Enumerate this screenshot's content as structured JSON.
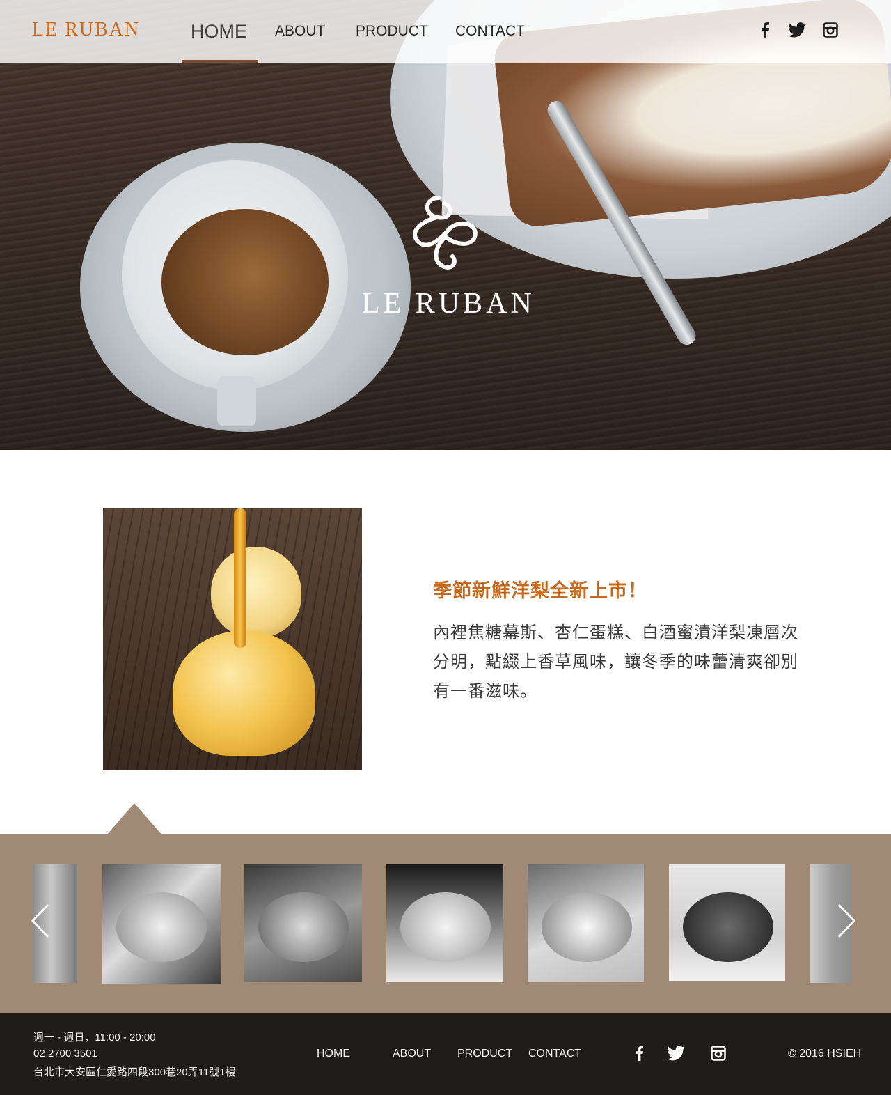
{
  "header": {
    "brand": "LE RUBAN",
    "nav": [
      {
        "label": "HOME",
        "active": true
      },
      {
        "label": "ABOUT"
      },
      {
        "label": "PRODUCT"
      },
      {
        "label": "CONTACT"
      }
    ],
    "social": [
      "facebook-icon",
      "twitter-icon",
      "instagram-icon"
    ]
  },
  "hero": {
    "logo_text": "LE RUBAN"
  },
  "feature": {
    "title": "季節新鮮洋梨全新上市！",
    "body": "內裡焦糖幕斯、杏仁蛋糕、白酒蜜漬洋梨凍層次分明，點綴上香草風味，讓冬季的味蕾清爽卻別有一番滋味。"
  },
  "gallery": {
    "items": [
      "cake-thumb-1",
      "cake-thumb-2",
      "cake-thumb-3",
      "cake-thumb-4",
      "cake-thumb-5",
      "cake-thumb-6",
      "cake-thumb-7",
      "cake-thumb-8"
    ],
    "prev_icon": "chevron-left-icon",
    "next_icon": "chevron-right-icon",
    "background": "#a08a75"
  },
  "footer": {
    "hours": "週一 - 週日，11:00 - 20:00",
    "phone": "02 2700 3501",
    "address": "台北市大安區仁愛路四段300巷20弄11號1樓",
    "nav": [
      "HOME",
      "ABOUT",
      "PRODUCT",
      "CONTACT"
    ],
    "copyright": "© 2016  HSIEH"
  },
  "colors": {
    "accent": "#c8691d",
    "footer_bg": "#1e1d1c"
  }
}
